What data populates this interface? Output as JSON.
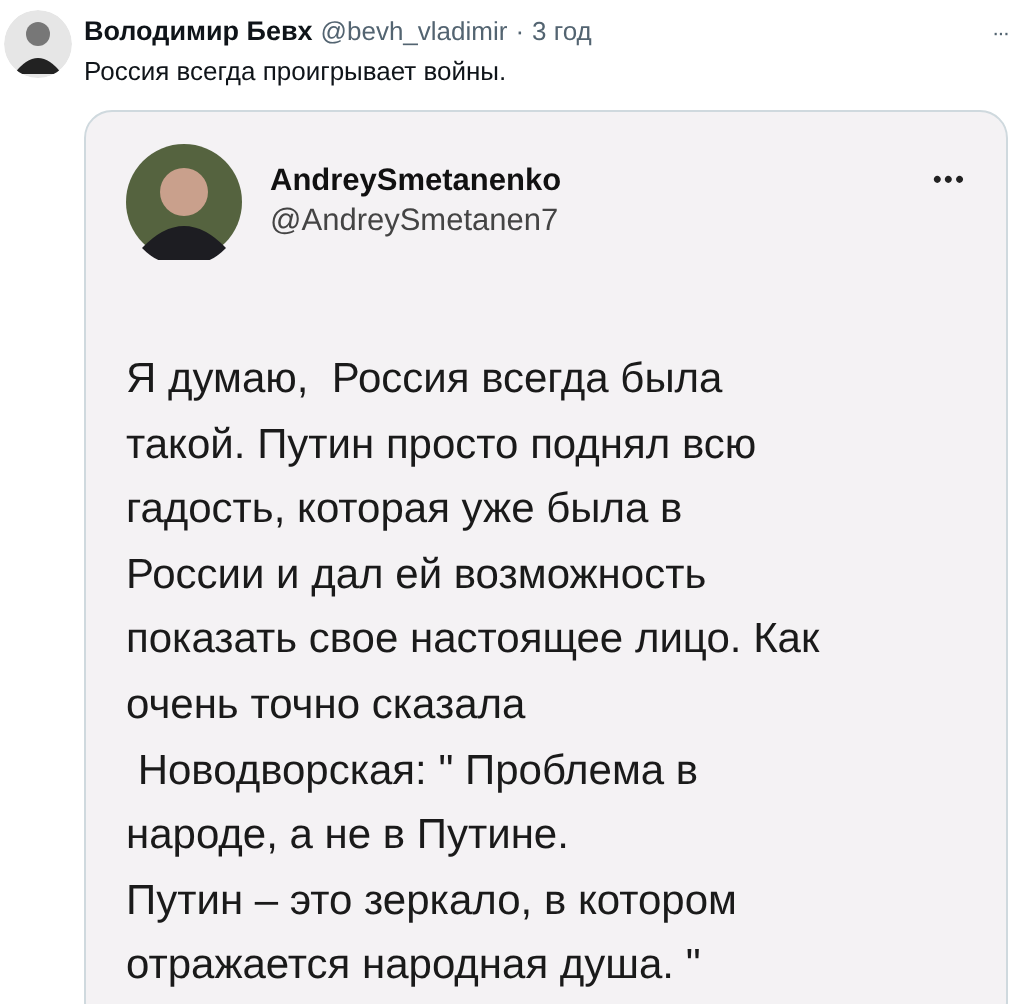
{
  "tweet": {
    "name": "Володимир Бевх",
    "handle": "@bevh_vladimir",
    "separator": "·",
    "time": "3 год",
    "more": "···",
    "text": "Россия всегда проигрывает войны.",
    "embedded_post": {
      "name": "AndreySmetanenko",
      "handle": "@AndreySmetanen7",
      "more": "•••",
      "lines": [
        "Я думаю,  Россия всегда была",
        "такой. Путин просто поднял всю",
        "гадость, которая уже была в",
        "России и дал ей возможность",
        "показать свое настоящее лицо. Как",
        "очень точно сказала",
        " Новодворская: \" Проблема в",
        "народе, а не в Путине.",
        "Путин – это зеркало, в котором",
        "отражается народная душа. \""
      ]
    }
  }
}
